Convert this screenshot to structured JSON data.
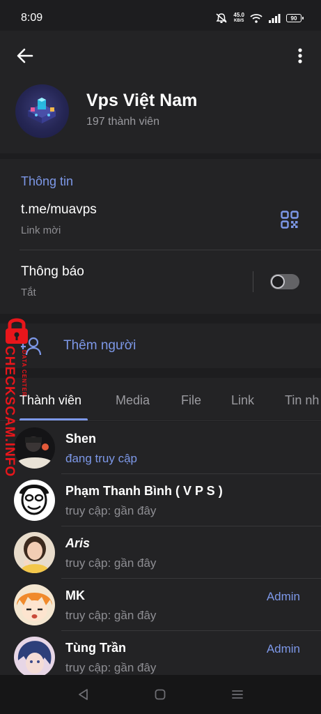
{
  "status_bar": {
    "time": "8:09",
    "speed_value": "45.0",
    "speed_unit": "KB/S",
    "battery": "90"
  },
  "group": {
    "title": "Vps Việt Nam",
    "subtitle": "197 thành viên"
  },
  "info": {
    "section_title": "Thông tin",
    "link": "t.me/muavps",
    "link_caption": "Link mời",
    "notifications_label": "Thông báo",
    "notifications_state": "Tắt"
  },
  "add_member": {
    "label": "Thêm người"
  },
  "tabs": [
    {
      "label": "Thành viên",
      "active": true
    },
    {
      "label": "Media",
      "active": false
    },
    {
      "label": "File",
      "active": false
    },
    {
      "label": "Link",
      "active": false
    },
    {
      "label": "Tin nh",
      "active": false
    }
  ],
  "members": [
    {
      "name": "Shen",
      "status": "đang truy cập",
      "role": ""
    },
    {
      "name": "Phạm Thanh Bình ( V P S )",
      "status": "truy cập: gần đây",
      "role": ""
    },
    {
      "name": "Aris",
      "status": "truy cập: gần đây",
      "role": ""
    },
    {
      "name": "MK",
      "status": "truy cập: gần đây",
      "role": "Admin"
    },
    {
      "name": "Tùng Trần",
      "status": "truy cập: gần đây",
      "role": "Admin"
    }
  ],
  "watermark": {
    "main": "CHECKSCAM.INFO",
    "small": "DATA CENTER"
  },
  "colors": {
    "accent": "#7d98e8",
    "background": "#1d1d1f",
    "surface": "#232325",
    "watermark": "#e8161b"
  },
  "icons": [
    "back-arrow-icon",
    "more-vertical-icon",
    "qr-code-icon",
    "add-user-icon",
    "nav-back-icon",
    "nav-home-icon",
    "nav-menu-icon",
    "lock-icon",
    "wifi-icon",
    "signal-icon",
    "mute-icon"
  ]
}
